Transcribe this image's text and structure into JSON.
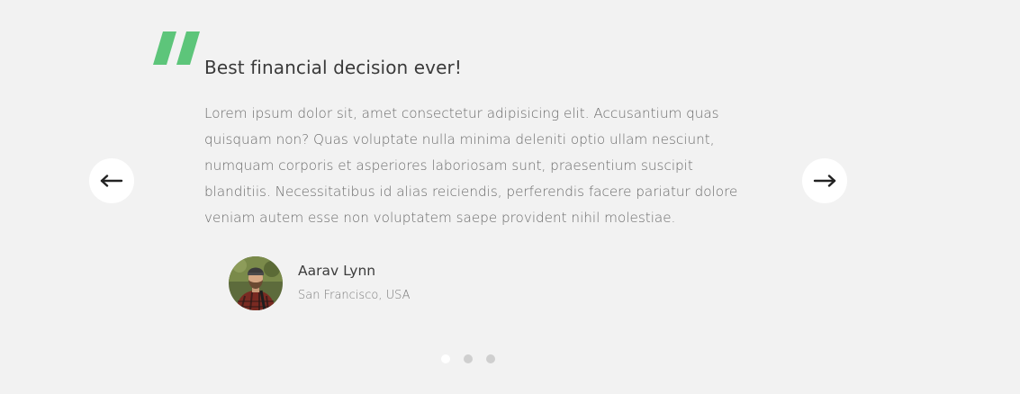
{
  "testimonial": {
    "title": "Best financial decision ever!",
    "body": "Lorem ipsum dolor sit, amet consectetur adipisicing elit. Accusantium quas quisquam non? Quas voluptate nulla minima deleniti optio ullam nesciunt, numquam corporis et asperiores laboriosam sunt, praesentium suscipit blanditiis. Necessitatibus id alias reiciendis, perferendis facere pariatur dolore veniam autem esse non voluptatem saepe provident nihil molestiae.",
    "author": {
      "name": "Aarav Lynn",
      "location": "San Francisco, USA"
    }
  },
  "slider": {
    "total_slides": 3,
    "active_index": 0
  },
  "icons": {
    "quote": "quote-icon",
    "prev": "arrow-left-icon",
    "next": "arrow-right-icon"
  },
  "colors": {
    "accent": "#5dc57a",
    "background": "#f2f2f2",
    "heading": "#3a3a3a",
    "text": "#6c6c6c"
  }
}
